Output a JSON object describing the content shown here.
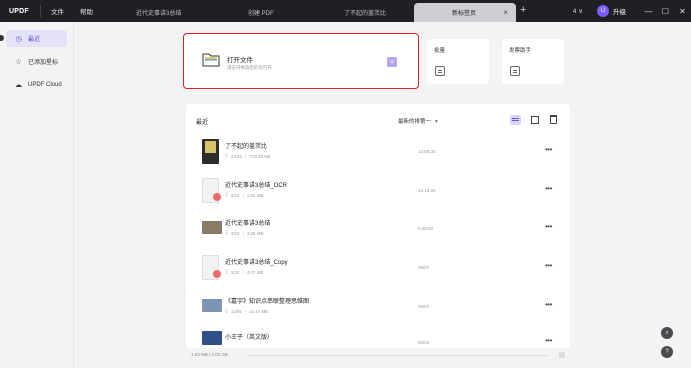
{
  "titlebar": {
    "logo": "UPDF",
    "menu": [
      "文件",
      "帮助"
    ],
    "tabs": [
      {
        "label": "近代史事讲3总结"
      },
      {
        "label": "创建 PDF"
      },
      {
        "label": "了不起的盖茨比"
      },
      {
        "label": "新标签页",
        "active": true
      }
    ],
    "tab_close": "×",
    "plus": "+",
    "counter": "4",
    "counter_caret": "∨",
    "avatar_letter": "U",
    "upgrade_label": "升级",
    "window_buttons": [
      "—",
      "☐",
      "✕"
    ]
  },
  "sidebar": {
    "items": [
      {
        "label": "最近",
        "icon": "clock-icon",
        "glyph": "◷"
      },
      {
        "label": "已添加星标",
        "icon": "star-icon",
        "glyph": "☆"
      },
      {
        "label": "UPDF Cloud",
        "icon": "cloud-icon",
        "glyph": "☁"
      }
    ]
  },
  "open_file": {
    "title": "打开文件",
    "subtitle": "请支持拖放您的您打开",
    "add": "+"
  },
  "quick_cards": [
    {
      "label": "批量"
    },
    {
      "label": "发票助手"
    }
  ],
  "recent": {
    "title": "最近",
    "sort_label": "最新的排第一",
    "sort_caret": "▾",
    "files": [
      {
        "name": "了不起的盖茨比",
        "pages": "2/193",
        "size": "773.38 KB",
        "time": "14:55:30",
        "thumb": "book"
      },
      {
        "name": "近代史事讲3总结_OCR",
        "pages": "3/22",
        "size": "1.04 MB",
        "time": "14:18:34",
        "thumb": "file"
      },
      {
        "name": "近代史事讲3总结",
        "pages": "3/22",
        "size": "4.05 MB",
        "time": "5:48:43",
        "thumb": "photo"
      },
      {
        "name": "近代史事讲3总结_Copy",
        "pages": "2/22",
        "size": "4.07 MB",
        "time": "05/07",
        "thumb": "file"
      },
      {
        "name": "《嘉宇》知识点串联整理思维图",
        "pages": "11/85",
        "size": "14.44 MB",
        "time": "05/07",
        "thumb": "photo2"
      },
      {
        "name": "小王子（英文版）",
        "pages": "",
        "size": "",
        "time": "05/04",
        "thumb": "blue"
      }
    ],
    "more": "•••",
    "page_icon": "▯",
    "meta_sep": "|"
  },
  "status": {
    "text": "1.63 MB | 2.00 GB"
  },
  "fab": {
    "search": "⌕",
    "help": "?"
  }
}
